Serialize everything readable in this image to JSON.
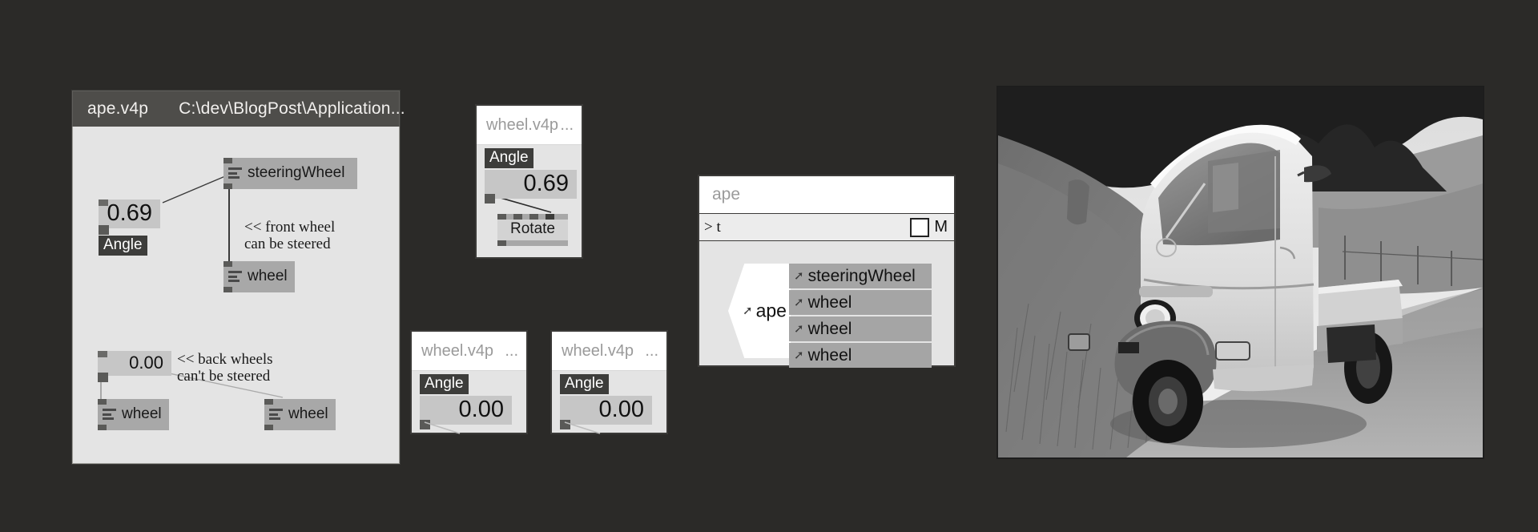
{
  "background_color": "#2b2a28",
  "main_window": {
    "title_file": "ape.v4p",
    "title_path": "C:\\dev\\BlogPost\\Application...",
    "nodes": [
      {
        "label": "steeringWheel",
        "icon": "node-lines-icon"
      },
      {
        "label": "wheel",
        "icon": "node-lines-icon"
      },
      {
        "label": "wheel",
        "icon": "node-lines-icon"
      },
      {
        "label": "wheel",
        "icon": "node-lines-icon"
      }
    ],
    "ioboxes": [
      {
        "value": "0.69",
        "tag": "Angle"
      },
      {
        "value": "0.00",
        "tag": ""
      }
    ],
    "comments": [
      "<< front wheel\ncan be steered",
      "<< back wheels\ncan't be steered"
    ]
  },
  "wheel_windows": [
    {
      "title": "wheel.v4p",
      "title_ellipsis": "...",
      "tag": "Angle",
      "value": "0.69",
      "node_label": "Rotate"
    },
    {
      "title": "wheel.v4p",
      "title_ellipsis": "...",
      "tag": "Angle",
      "value": "0.00",
      "node_label": ""
    },
    {
      "title": "wheel.v4p",
      "title_ellipsis": "...",
      "tag": "Angle",
      "value": "0.00",
      "node_label": ""
    }
  ],
  "explorer": {
    "search_value": "ape",
    "filter_text": "> t",
    "checkbox_label": "M",
    "checkbox_checked": false,
    "root_label": "ape",
    "rows": [
      {
        "label": "steeringWheel"
      },
      {
        "label": "wheel"
      },
      {
        "label": "wheel"
      },
      {
        "label": "wheel"
      }
    ]
  },
  "photo": {
    "alt": "Black and white photograph of a three-wheeled Piaggio Ape pickup truck parked on a country road"
  }
}
